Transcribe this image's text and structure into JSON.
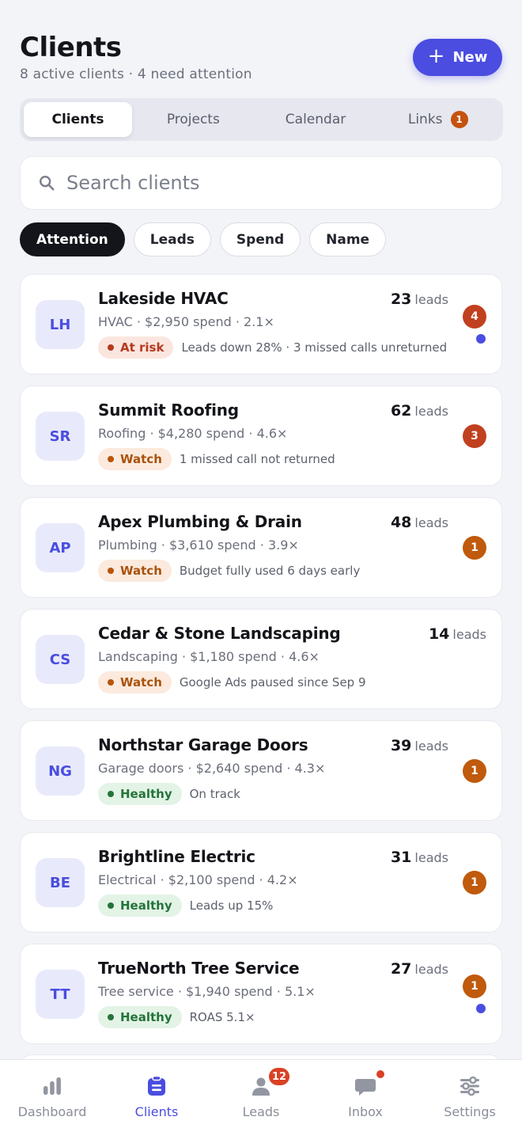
{
  "header": {
    "title": "Clients",
    "subtitle": "8 active clients · 4 need attention",
    "new_button": "New"
  },
  "tabs": [
    {
      "label": "Clients",
      "active": true
    },
    {
      "label": "Projects"
    },
    {
      "label": "Calendar"
    },
    {
      "label": "Links",
      "badge": "1"
    }
  ],
  "search": {
    "placeholder": "Search clients"
  },
  "filters": [
    {
      "label": "Attention",
      "active": true
    },
    {
      "label": "Leads"
    },
    {
      "label": "Spend"
    },
    {
      "label": "Name"
    }
  ],
  "clients": [
    {
      "initials": "LH",
      "name": "Lakeside HVAC",
      "meta": "HVAC · $2,950 spend · 2.1×",
      "status": "At risk",
      "status_type": "risk",
      "note": "Leads down 28% · 3 missed calls unreturned",
      "leads": "23",
      "leads_unit": "leads",
      "badge": "4",
      "badge_color": "red",
      "unread": true
    },
    {
      "initials": "SR",
      "name": "Summit Roofing",
      "meta": "Roofing · $4,280 spend · 4.6×",
      "status": "Watch",
      "status_type": "watch",
      "note": "1 missed call not returned",
      "leads": "62",
      "leads_unit": "leads",
      "badge": "3",
      "badge_color": "red",
      "unread": false
    },
    {
      "initials": "AP",
      "name": "Apex Plumbing & Drain",
      "meta": "Plumbing · $3,610 spend · 3.9×",
      "status": "Watch",
      "status_type": "watch",
      "note": "Budget fully used 6 days early",
      "leads": "48",
      "leads_unit": "leads",
      "badge": "1",
      "badge_color": "orange",
      "unread": false
    },
    {
      "initials": "CS",
      "name": "Cedar & Stone Landscaping",
      "meta": "Landscaping · $1,180 spend · 4.6×",
      "status": "Watch",
      "status_type": "watch",
      "note": "Google Ads paused since Sep 9",
      "leads": "14",
      "leads_unit": "leads",
      "badge": "",
      "badge_color": "",
      "unread": false
    },
    {
      "initials": "NG",
      "name": "Northstar Garage Doors",
      "meta": "Garage doors · $2,640 spend · 4.3×",
      "status": "Healthy",
      "status_type": "healthy",
      "note": "On track",
      "leads": "39",
      "leads_unit": "leads",
      "badge": "1",
      "badge_color": "orange",
      "unread": false
    },
    {
      "initials": "BE",
      "name": "Brightline Electric",
      "meta": "Electrical · $2,100 spend · 4.2×",
      "status": "Healthy",
      "status_type": "healthy",
      "note": "Leads up 15%",
      "leads": "31",
      "leads_unit": "leads",
      "badge": "1",
      "badge_color": "orange",
      "unread": false
    },
    {
      "initials": "TT",
      "name": "TrueNorth Tree Service",
      "meta": "Tree service · $1,940 spend · 5.1×",
      "status": "Healthy",
      "status_type": "healthy",
      "note": "ROAS 5.1×",
      "leads": "27",
      "leads_unit": "leads",
      "badge": "1",
      "badge_color": "orange",
      "unread": true
    }
  ],
  "nav": [
    {
      "label": "Dashboard",
      "icon": "bar-chart-icon"
    },
    {
      "label": "Clients",
      "icon": "clients-icon",
      "active": true
    },
    {
      "label": "Leads",
      "icon": "person-icon",
      "badge": "12"
    },
    {
      "label": "Inbox",
      "icon": "chat-icon",
      "dot": true
    },
    {
      "label": "Settings",
      "icon": "sliders-icon"
    }
  ],
  "colors": {
    "accent": "#4a4de0",
    "risk": "#c1401f",
    "watch": "#c05a0c",
    "healthy": "#24733a"
  }
}
